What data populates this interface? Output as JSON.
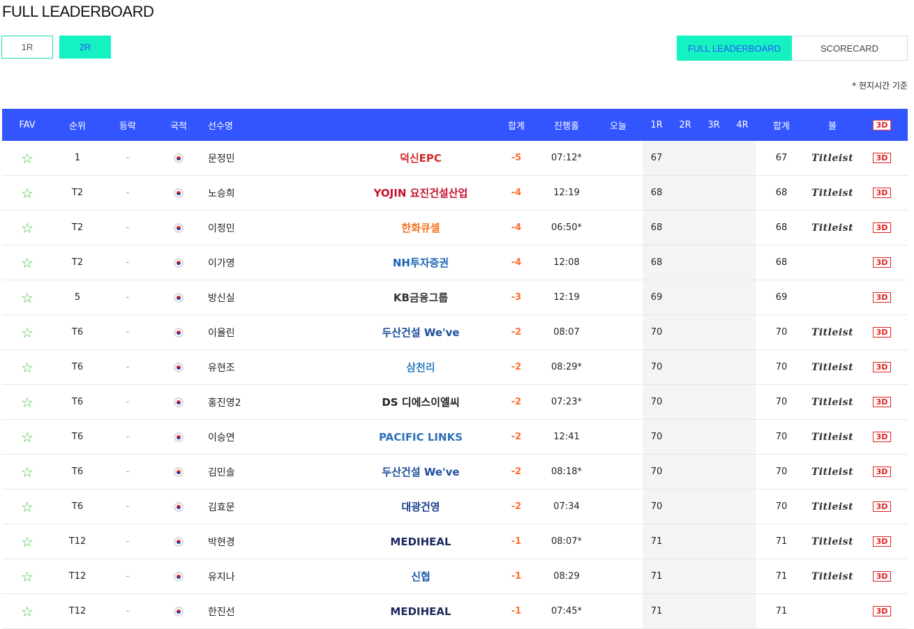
{
  "page_title": "FULL LEADERBOARD",
  "rounds": [
    "1R",
    "2R"
  ],
  "tabs": [
    "FULL LEADERBOARD",
    "SCORECARD"
  ],
  "note": "* 현지시간 기준",
  "headers": {
    "fav": "FAV",
    "rank": "순위",
    "change": "등락",
    "country": "국적",
    "player": "선수명",
    "total": "합계",
    "thru": "진행홀",
    "today": "오늘",
    "r1": "1R",
    "r2": "2R",
    "r3": "3R",
    "r4": "4R",
    "strokes": "합계",
    "ball": "볼",
    "view3d": "3D"
  },
  "rows": [
    {
      "fav": "☆",
      "rank": "1",
      "change": "-",
      "name": "문정민",
      "sponsor": "덕신EPC",
      "sponsor_color": "#d42a2a",
      "total": "-5",
      "thru": "07:12*",
      "r1": "67",
      "strokes": "67",
      "ball": "Titleist",
      "view3d": "3D"
    },
    {
      "fav": "☆",
      "rank": "T2",
      "change": "-",
      "name": "노승희",
      "sponsor": "YOJIN 요진건설산업",
      "sponsor_color": "#c8102e",
      "total": "-4",
      "thru": "12:19",
      "r1": "68",
      "strokes": "68",
      "ball": "Titleist",
      "view3d": "3D"
    },
    {
      "fav": "☆",
      "rank": "T2",
      "change": "-",
      "name": "이정민",
      "sponsor": "한화큐셀",
      "sponsor_color": "#f37321",
      "total": "-4",
      "thru": "06:50*",
      "r1": "68",
      "strokes": "68",
      "ball": "Titleist",
      "view3d": "3D"
    },
    {
      "fav": "☆",
      "rank": "T2",
      "change": "-",
      "name": "이가영",
      "sponsor": "NH투자증권",
      "sponsor_color": "#1a64b4",
      "total": "-4",
      "thru": "12:08",
      "r1": "68",
      "strokes": "68",
      "ball": "",
      "view3d": "3D"
    },
    {
      "fav": "☆",
      "rank": "5",
      "change": "-",
      "name": "방신실",
      "sponsor": "KB금융그룹",
      "sponsor_color": "#333333",
      "total": "-3",
      "thru": "12:19",
      "r1": "69",
      "strokes": "69",
      "ball": "",
      "view3d": "3D"
    },
    {
      "fav": "☆",
      "rank": "T6",
      "change": "-",
      "name": "이율린",
      "sponsor": "두산건설 We've",
      "sponsor_color": "#1b4f9c",
      "total": "-2",
      "thru": "08:07",
      "r1": "70",
      "strokes": "70",
      "ball": "Titleist",
      "view3d": "3D"
    },
    {
      "fav": "☆",
      "rank": "T6",
      "change": "-",
      "name": "유현조",
      "sponsor": "삼천리",
      "sponsor_color": "#2f7fc4",
      "total": "-2",
      "thru": "08:29*",
      "r1": "70",
      "strokes": "70",
      "ball": "Titleist",
      "view3d": "3D"
    },
    {
      "fav": "☆",
      "rank": "T6",
      "change": "-",
      "name": "홍진영2",
      "sponsor": "DS 디에스이엘씨",
      "sponsor_color": "#222222",
      "total": "-2",
      "thru": "07:23*",
      "r1": "70",
      "strokes": "70",
      "ball": "Titleist",
      "view3d": "3D"
    },
    {
      "fav": "☆",
      "rank": "T6",
      "change": "-",
      "name": "이승연",
      "sponsor": "PACIFIC LINKS",
      "sponsor_color": "#2f6fb5",
      "total": "-2",
      "thru": "12:41",
      "r1": "70",
      "strokes": "70",
      "ball": "Titleist",
      "view3d": "3D"
    },
    {
      "fav": "☆",
      "rank": "T6",
      "change": "-",
      "name": "김민솔",
      "sponsor": "두산건설 We've",
      "sponsor_color": "#1b4f9c",
      "total": "-2",
      "thru": "08:18*",
      "r1": "70",
      "strokes": "70",
      "ball": "Titleist",
      "view3d": "3D"
    },
    {
      "fav": "☆",
      "rank": "T6",
      "change": "-",
      "name": "김효문",
      "sponsor": "대광건영",
      "sponsor_color": "#1b3f8f",
      "total": "-2",
      "thru": "07:34",
      "r1": "70",
      "strokes": "70",
      "ball": "Titleist",
      "view3d": "3D"
    },
    {
      "fav": "☆",
      "rank": "T12",
      "change": "-",
      "name": "박현경",
      "sponsor": "MEDIHEAL",
      "sponsor_color": "#1b2a5c",
      "total": "-1",
      "thru": "08:07*",
      "r1": "71",
      "strokes": "71",
      "ball": "Titleist",
      "view3d": "3D"
    },
    {
      "fav": "☆",
      "rank": "T12",
      "change": "-",
      "name": "유지나",
      "sponsor": "신협",
      "sponsor_color": "#1e5aa8",
      "total": "-1",
      "thru": "08:29",
      "r1": "71",
      "strokes": "71",
      "ball": "Titleist",
      "view3d": "3D"
    },
    {
      "fav": "☆",
      "rank": "T12",
      "change": "-",
      "name": "한진선",
      "sponsor": "MEDIHEAL",
      "sponsor_color": "#1b2a5c",
      "total": "-1",
      "thru": "07:45*",
      "r1": "71",
      "strokes": "71",
      "ball": "",
      "view3d": "3D"
    }
  ]
}
